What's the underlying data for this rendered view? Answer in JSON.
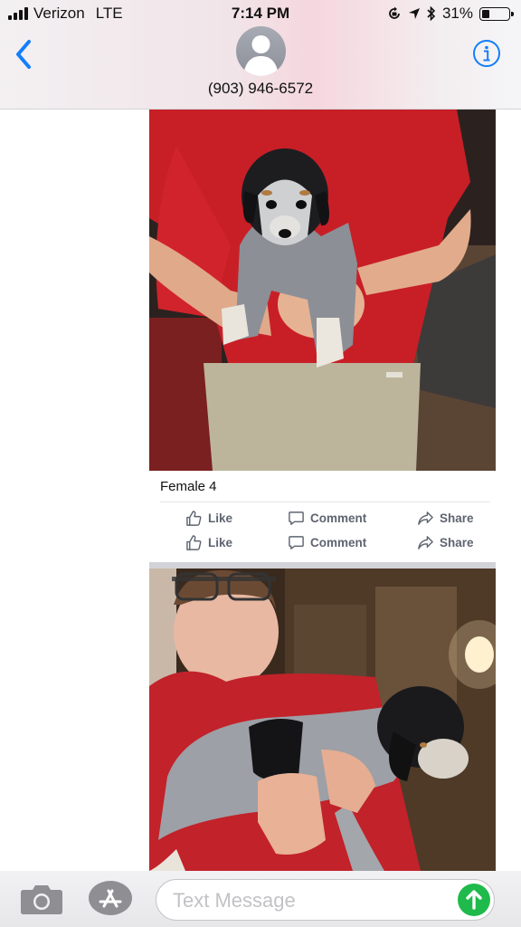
{
  "status_bar": {
    "carrier": "Verizon",
    "network": "LTE",
    "time": "7:14 PM",
    "battery": "31%",
    "battery_level": 0.31,
    "signal_bars": 4
  },
  "header": {
    "contact": "(903) 946-6572",
    "back_icon": "chevron-left-icon",
    "info_icon": "info-icon"
  },
  "message": {
    "post1": {
      "caption": "Female 4",
      "actions": [
        {
          "like": "Like",
          "comment": "Comment",
          "share": "Share"
        },
        {
          "like": "Like",
          "comment": "Comment",
          "share": "Share"
        }
      ]
    }
  },
  "input_bar": {
    "placeholder": "Text Message",
    "camera_icon": "camera-icon",
    "apps_icon": "app-store-icon",
    "send_icon": "arrow-up-icon"
  },
  "colors": {
    "accent_blue": "#147efb",
    "send_green": "#1fba4b",
    "facebook_gray": "#5e6470"
  }
}
